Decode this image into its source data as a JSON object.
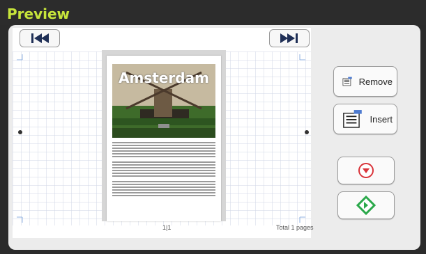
{
  "window": {
    "title": "Preview"
  },
  "nav": {
    "first_icon": "skip-back-icon",
    "last_icon": "skip-forward-icon"
  },
  "document": {
    "photo_title": "Amsterdam"
  },
  "status": {
    "page_number": "1|1",
    "total_pages": "Total 1 pages"
  },
  "actions": {
    "remove_label": "Remove",
    "remove_icon": "remove-page-icon",
    "insert_label": "Insert",
    "insert_icon": "insert-page-icon",
    "stop_icon": "stop-circle-icon",
    "start_icon": "start-diamond-icon"
  },
  "colors": {
    "title": "#c7e53b",
    "stop_red": "#d9343a",
    "start_green": "#2aa84a",
    "grid_line": "#cfd6e6"
  }
}
